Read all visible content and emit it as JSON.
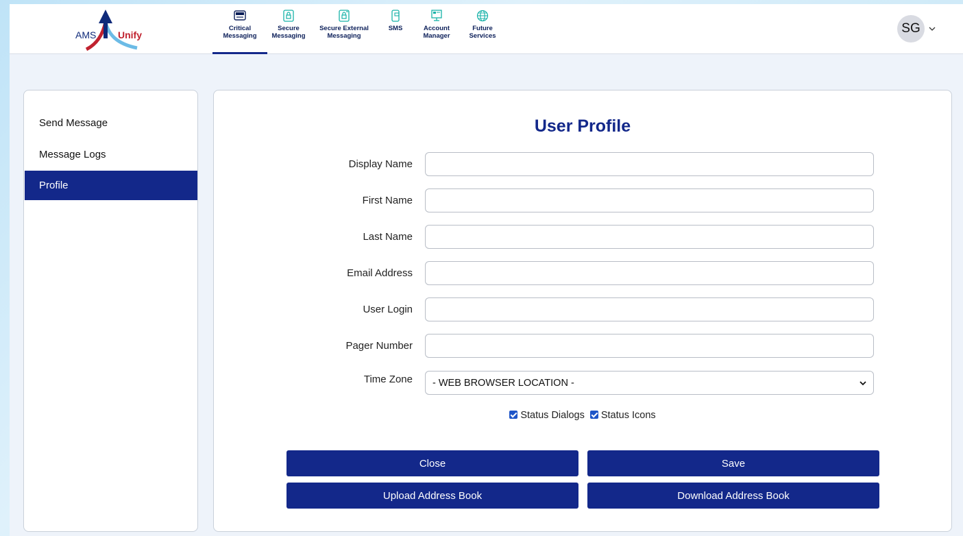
{
  "brand": {
    "left": "AMS",
    "right": "Unify"
  },
  "nav": [
    {
      "label": "Critical\nMessaging",
      "icon": "pager-icon",
      "active": true
    },
    {
      "label": "Secure\nMessaging",
      "icon": "secure-message-icon",
      "active": false
    },
    {
      "label": "Secure External\nMessaging",
      "icon": "secure-external-icon",
      "active": false
    },
    {
      "label": "SMS",
      "icon": "sms-phone-icon",
      "active": false
    },
    {
      "label": "Account\nManager",
      "icon": "account-manager-icon",
      "active": false
    },
    {
      "label": "Future\nServices",
      "icon": "globe-icon",
      "active": false
    }
  ],
  "user": {
    "initials": "SG"
  },
  "sidebar": {
    "items": [
      {
        "label": "Send Message",
        "active": false
      },
      {
        "label": "Message Logs",
        "active": false
      },
      {
        "label": "Profile",
        "active": true
      }
    ]
  },
  "profile": {
    "title": "User Profile",
    "fields": [
      {
        "label": "Display Name",
        "value": ""
      },
      {
        "label": "First Name",
        "value": ""
      },
      {
        "label": "Last Name",
        "value": ""
      },
      {
        "label": "Email Address",
        "value": ""
      },
      {
        "label": "User Login",
        "value": ""
      },
      {
        "label": "Pager Number",
        "value": ""
      }
    ],
    "timezone": {
      "label": "Time Zone",
      "value": "- WEB BROWSER LOCATION -"
    },
    "checkboxes": [
      {
        "label": "Status Dialogs",
        "checked": true
      },
      {
        "label": "Status Icons",
        "checked": true
      }
    ],
    "buttons": {
      "close": "Close",
      "save": "Save",
      "upload": "Upload Address Book",
      "download": "Download Address Book"
    }
  },
  "colors": {
    "primary": "#13288a",
    "accent_red": "#c0222f",
    "checkbox": "#1e55c8"
  }
}
